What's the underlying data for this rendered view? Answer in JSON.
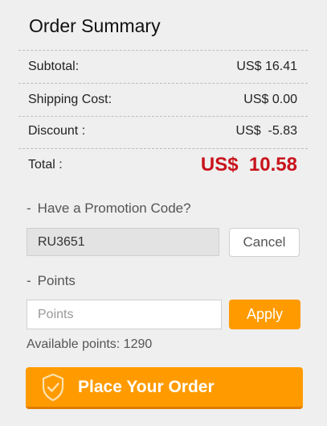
{
  "summary": {
    "title": "Order Summary",
    "rows": [
      {
        "label": "Subtotal:",
        "value": "US$ 16.41"
      },
      {
        "label": "Shipping Cost:",
        "value": "US$ 0.00"
      },
      {
        "label": "Discount :",
        "value": "US$  -5.83"
      }
    ],
    "total": {
      "label": "Total :",
      "value": "US$  10.58"
    }
  },
  "promo": {
    "bullet": "-",
    "label": "Have a Promotion Code?",
    "code_value": "RU3651",
    "cancel_label": "Cancel"
  },
  "points": {
    "bullet": "-",
    "label": "Points",
    "placeholder": "Points",
    "apply_label": "Apply",
    "available_text": "Available points: 1290"
  },
  "order": {
    "button_label": "Place Your Order",
    "icon": "shield-check-icon"
  },
  "colors": {
    "accent": "#ff9b00",
    "total": "#c8131b",
    "background": "#efefef"
  }
}
